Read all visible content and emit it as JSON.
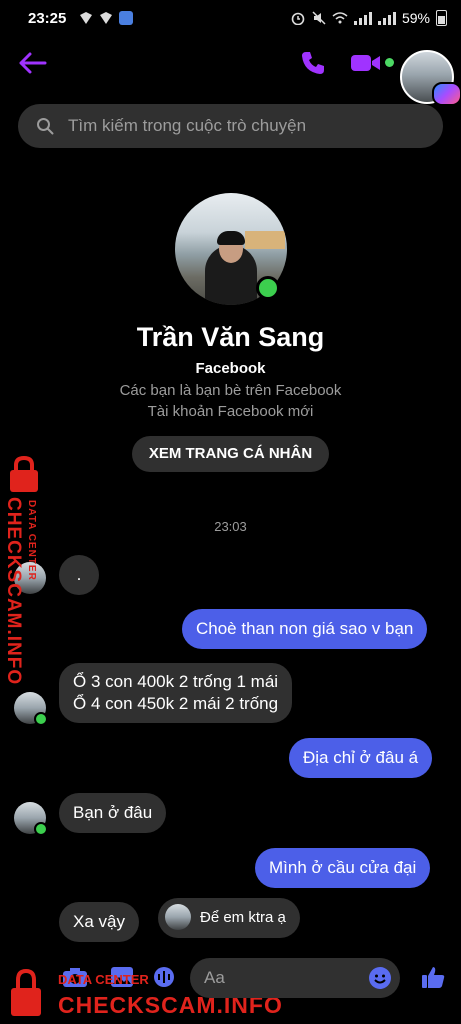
{
  "status_bar": {
    "time": "23:25",
    "battery": "59%"
  },
  "search": {
    "placeholder": "Tìm kiếm trong cuộc trò chuyện"
  },
  "profile": {
    "name": "Trần Văn Sang",
    "platform": "Facebook",
    "relation": "Các bạn là bạn bè trên Facebook",
    "account_note": "Tài khoản Facebook mới",
    "view_profile_label": "XEM TRANG CÁ NHÂN"
  },
  "timestamp": "23:03",
  "messages": [
    {
      "from": "them",
      "text": "."
    },
    {
      "from": "me",
      "text": "Choè than non giá sao v bạn"
    },
    {
      "from": "them",
      "lines": [
        "Ổ 3 con 400k 2 trống 1 mái",
        "Ổ 4 con 450k 2 mái 2 trống"
      ]
    },
    {
      "from": "me",
      "text": "Địa chỉ ở đâu á"
    },
    {
      "from": "them",
      "text": "Bạn ở đâu"
    },
    {
      "from": "me",
      "text": "Mình ở cầu cửa đại"
    },
    {
      "from": "them",
      "text": "Xa vậy"
    },
    {
      "from": "them",
      "text": "Để em ktra ạ"
    }
  ],
  "composer": {
    "placeholder": "Aa"
  },
  "watermark": {
    "brand": "CHECKSCAM.INFO",
    "tag": "DATA CENTER"
  },
  "colors": {
    "accent": "#a033ff",
    "outgoing": "#4c5fe8",
    "online": "#3ccf4e",
    "watermark": "#e0231c"
  }
}
